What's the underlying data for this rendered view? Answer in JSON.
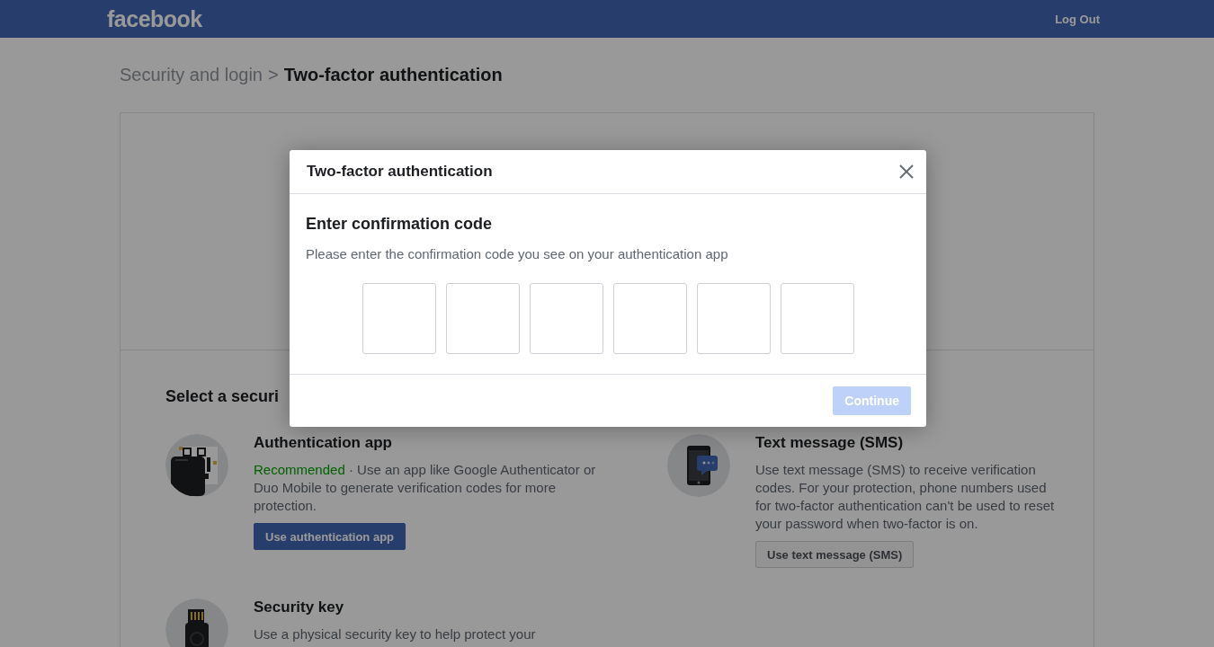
{
  "header": {
    "logo": "facebook",
    "logout": "Log Out"
  },
  "breadcrumb": {
    "parent": "Security and login",
    "separator": ">",
    "current": "Two-factor authentication"
  },
  "section": {
    "title": "Select a securi"
  },
  "methods": [
    {
      "kind": "app",
      "title": "Authentication app",
      "badge": "Recommended",
      "description": "· Use an app like Google Authenticator or Duo Mobile to generate verification codes for more protection.",
      "button": "Use authentication app",
      "primary": true
    },
    {
      "kind": "sms",
      "title": "Text message (SMS)",
      "description": "Use text message (SMS) to receive verification codes. For your protection, phone numbers used for two-factor authentication can't be used to reset your password when two-factor is on.",
      "button": "Use text message (SMS)",
      "primary": false
    },
    {
      "kind": "key",
      "title": "Security key",
      "description": "Use a physical security key to help protect your"
    }
  ],
  "dialog": {
    "title": "Two-factor authentication",
    "heading": "Enter confirmation code",
    "instruction": "Please enter the confirmation code you see on your authentication app",
    "code_fields": [
      {
        "filled": false
      },
      {
        "filled": false
      },
      {
        "filled": false
      },
      {
        "filled": false
      },
      {
        "filled": false
      },
      {
        "filled": false
      }
    ],
    "continue": {
      "label": "Continue",
      "disabled": true
    }
  }
}
